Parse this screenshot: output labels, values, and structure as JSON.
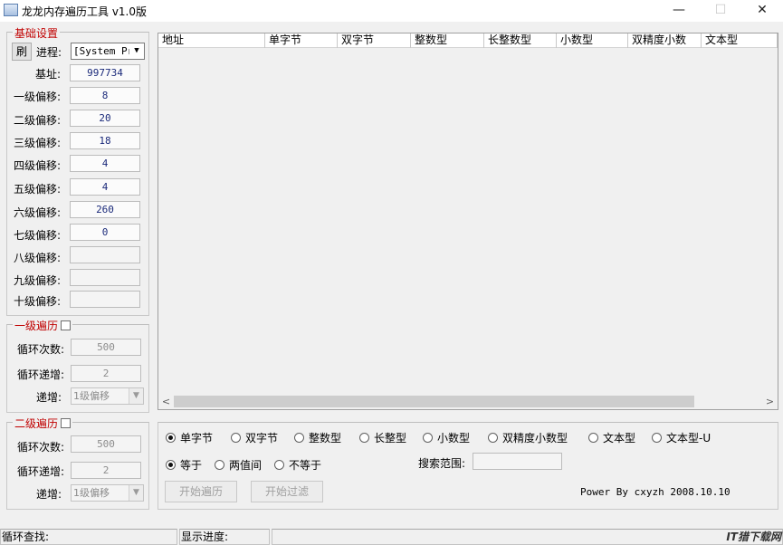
{
  "window": {
    "title": "龙龙内存遍历工具 v1.0版",
    "minimize": "—",
    "maximize": "☐",
    "close": "✕"
  },
  "base_settings": {
    "legend": "基础设置",
    "refresh_label": "刷",
    "process_label": "进程:",
    "process_value": "[System Pr:",
    "base_addr_label": "基址:",
    "base_addr_value": "997734",
    "offsets": [
      {
        "label": "一级偏移:",
        "value": "8"
      },
      {
        "label": "二级偏移:",
        "value": "20"
      },
      {
        "label": "三级偏移:",
        "value": "18"
      },
      {
        "label": "四级偏移:",
        "value": "4"
      },
      {
        "label": "五级偏移:",
        "value": "4"
      },
      {
        "label": "六级偏移:",
        "value": "260"
      },
      {
        "label": "七级偏移:",
        "value": "0"
      },
      {
        "label": "八级偏移:",
        "value": ""
      },
      {
        "label": "九级偏移:",
        "value": ""
      },
      {
        "label": "十级偏移:",
        "value": ""
      }
    ]
  },
  "loop1": {
    "legend": "一级遍历",
    "count_label": "循环次数:",
    "count_value": "500",
    "inc_label": "循环递增:",
    "inc_value": "2",
    "step_label": "递增:",
    "step_value": "1级偏移"
  },
  "loop2": {
    "legend": "二级遍历",
    "count_label": "循环次数:",
    "count_value": "500",
    "inc_label": "循环递增:",
    "inc_value": "2",
    "step_label": "递增:",
    "step_value": "1级偏移"
  },
  "results_table": {
    "columns": [
      "地址",
      "单字节",
      "双字节",
      "整数型",
      "长整数型",
      "小数型",
      "双精度小数",
      "文本型"
    ]
  },
  "search": {
    "types": [
      {
        "label": "单字节",
        "selected": true
      },
      {
        "label": "双字节",
        "selected": false
      },
      {
        "label": "整数型",
        "selected": false
      },
      {
        "label": "长整型",
        "selected": false
      },
      {
        "label": "小数型",
        "selected": false
      },
      {
        "label": "双精度小数型",
        "selected": false
      },
      {
        "label": "文本型",
        "selected": false
      },
      {
        "label": "文本型-U",
        "selected": false
      }
    ],
    "compare": [
      {
        "label": "等于",
        "selected": true
      },
      {
        "label": "两值间",
        "selected": false
      },
      {
        "label": "不等于",
        "selected": false
      }
    ],
    "range_label": "搜索范围:",
    "range_value": "",
    "start_button": "开始遍历",
    "filter_button": "开始过滤",
    "credit": "Power By cxyzh 2008.10.10"
  },
  "status": {
    "loop_search": "循环查找:",
    "progress": "显示进度:",
    "watermark": "IT猎下载网"
  }
}
